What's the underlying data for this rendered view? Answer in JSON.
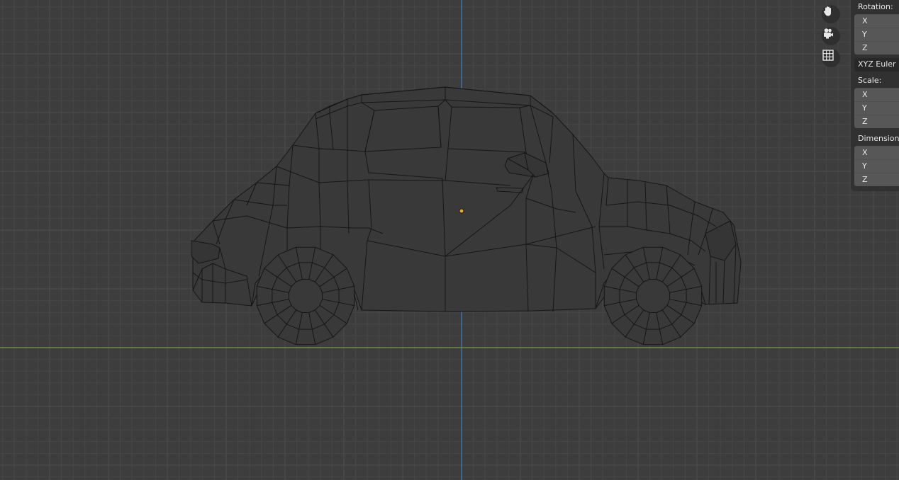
{
  "viewport": {
    "background": "#3d3d3d",
    "grid_minor": "#464646",
    "grid_major": "#4d4d4d",
    "axis_vertical": "#3f7fc0",
    "axis_horizontal": "#6b8f3c",
    "wire_color": "#161616",
    "origin_color": "#f5a623"
  },
  "navigation": {
    "pan_icon": "hand-icon",
    "camera_icon": "camera-icon",
    "ortho_icon": "grid-icon"
  },
  "properties": {
    "rotation": {
      "label": "Rotation:",
      "x": "X",
      "y": "Y",
      "z": "Z"
    },
    "rotation_mode": "XYZ Euler",
    "scale": {
      "label": "Scale:",
      "x": "X",
      "y": "Y",
      "z": "Z"
    },
    "dimensions": {
      "label": "Dimensions",
      "x": "X",
      "y": "Y",
      "z": "Z"
    }
  }
}
